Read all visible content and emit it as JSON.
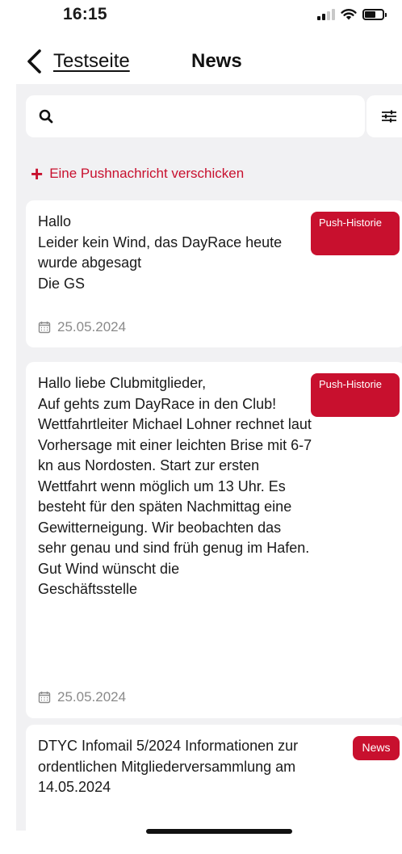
{
  "status_bar": {
    "time": "16:15"
  },
  "nav": {
    "back_label": "Testseite",
    "title": "News"
  },
  "search": {
    "value": "",
    "placeholder": ""
  },
  "actions": {
    "push_message": "Eine Pushnachricht verschicken"
  },
  "accent_color": "#c8102e",
  "news": [
    {
      "lines": [
        "Hallo",
        "Leider kein Wind, das DayRace heute wurde abgesagt",
        "Die GS"
      ],
      "badge": "Push-Historie",
      "date": "25.05.2024"
    },
    {
      "lines": [
        "Hallo liebe Clubmitglieder,",
        "Auf gehts zum DayRace in den Club! Wettfahrtleiter Michael Lohner rechnet laut Vorhersage mit einer leichten Brise mit 6-7 kn aus Nordosten. Start zur ersten Wettfahrt wenn möglich um 13 Uhr. Es besteht für den späten Nachmittag eine Gewitterneigung. Wir beobachten das sehr genau und sind früh genug im Hafen.",
        "Gut Wind wünscht die Geschäftsstelle"
      ],
      "badge": "Push-Historie",
      "date": "25.05.2024"
    },
    {
      "lines": [
        "DTYC Infomail 5/2024 Informationen zur ordentlichen Mitgliederversammlung am 14.05.2024"
      ],
      "badge": "News"
    }
  ]
}
